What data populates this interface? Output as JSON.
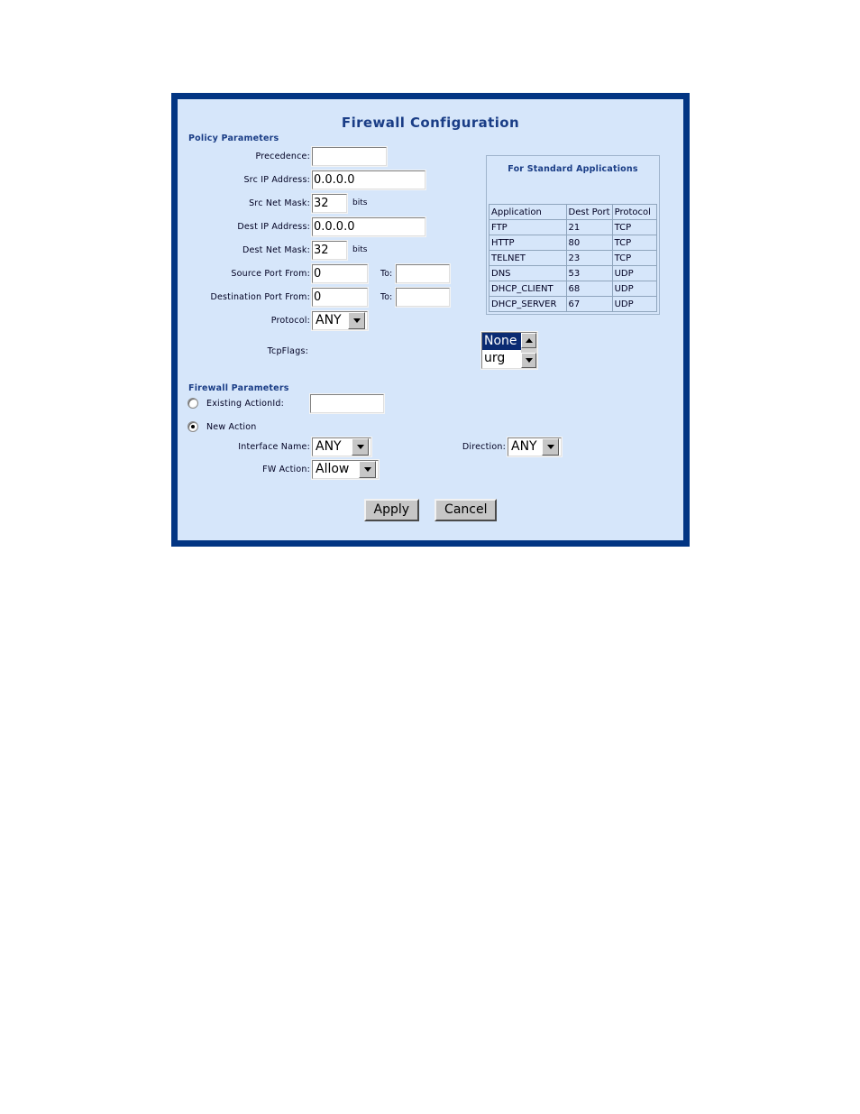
{
  "page": {
    "title": "Firewall Configuration"
  },
  "sections": {
    "policy_parameters": "Policy Parameters",
    "firewall_parameters": "Firewall Parameters"
  },
  "policy": {
    "precedence": {
      "label": "Precedence:",
      "value": ""
    },
    "src_ip": {
      "label": "Src IP Address:",
      "value": "0.0.0.0"
    },
    "src_mask": {
      "label": "Src Net Mask:",
      "value": "32",
      "suffix": "bits"
    },
    "dest_ip": {
      "label": "Dest IP Address:",
      "value": "0.0.0.0"
    },
    "dest_mask": {
      "label": "Dest Net Mask:",
      "value": "32",
      "suffix": "bits"
    },
    "source_port": {
      "label": "Source Port   From:",
      "from_value": "0",
      "to_label": "To:",
      "to_value": ""
    },
    "destination_port": {
      "label": "Destination Port   From:",
      "from_value": "0",
      "to_label": "To:",
      "to_value": ""
    },
    "protocol": {
      "label": "Protocol:",
      "value": "ANY"
    },
    "tcpflags": {
      "label": "TcpFlags:",
      "options": [
        "None",
        "urg"
      ],
      "selected": "None"
    }
  },
  "firewall": {
    "existing_action": {
      "label": "Existing ActionId:",
      "value": "",
      "selected": false
    },
    "new_action": {
      "label": "New Action",
      "selected": true
    },
    "interface_name": {
      "label": "Interface Name:",
      "value": "ANY"
    },
    "fw_action": {
      "label": "FW Action:",
      "value": "Allow"
    },
    "direction": {
      "label": "Direction:",
      "value": "ANY"
    }
  },
  "standard_applications": {
    "caption": "For Standard Applications",
    "columns": [
      "Application",
      "Dest Port",
      "Protocol"
    ],
    "rows": [
      [
        "FTP",
        "21",
        "TCP"
      ],
      [
        "HTTP",
        "80",
        "TCP"
      ],
      [
        "TELNET",
        "23",
        "TCP"
      ],
      [
        "DNS",
        "53",
        "UDP"
      ],
      [
        "DHCP_CLIENT",
        "68",
        "UDP"
      ],
      [
        "DHCP_SERVER",
        "67",
        "UDP"
      ]
    ]
  },
  "buttons": {
    "apply": "Apply",
    "cancel": "Cancel"
  },
  "colors": {
    "panel_border": "#023583",
    "panel_background": "#d6e6fa",
    "heading_text": "#1a3d86",
    "listbox_selection": "#0b2b72"
  }
}
